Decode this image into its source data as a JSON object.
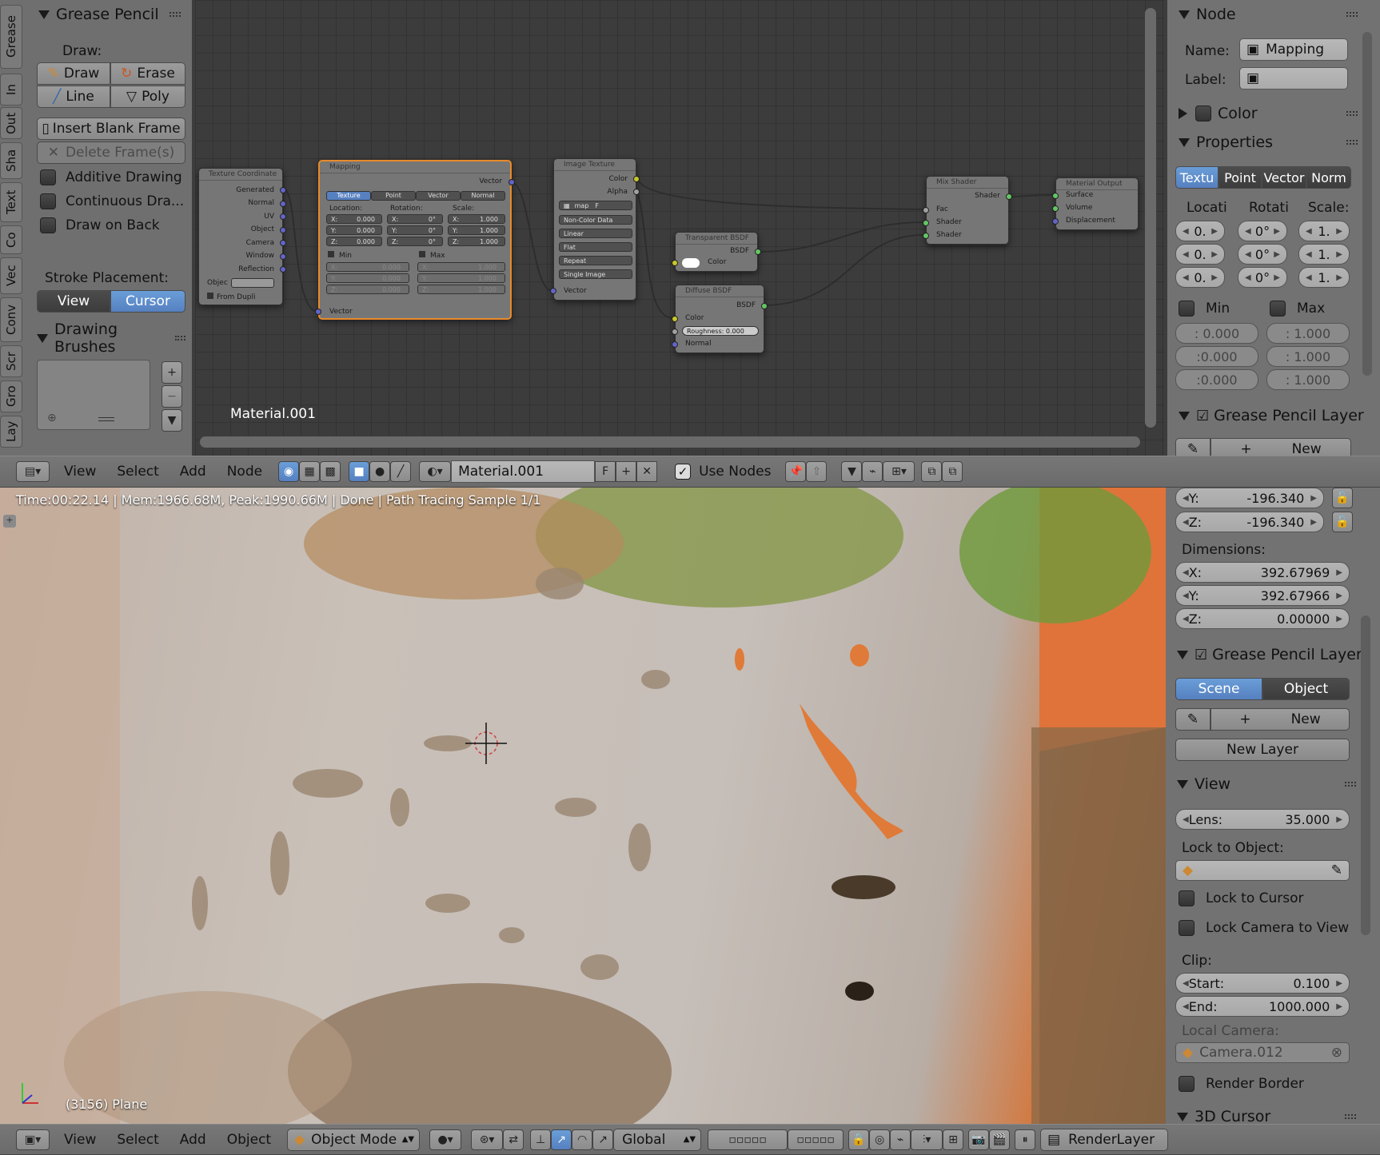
{
  "grease_pencil_panel": {
    "title": "Grease Pencil",
    "draw_label": "Draw:",
    "draw": "Draw",
    "erase": "Erase",
    "line": "Line",
    "poly": "Poly",
    "insert_blank_frame": "Insert Blank Frame",
    "delete_frames": "Delete Frame(s)",
    "additive_drawing": "Additive Drawing",
    "continuous_draw": "Continuous Dra...",
    "draw_on_back": "Draw on Back",
    "stroke_placement": "Stroke Placement:",
    "view": "View",
    "cursor": "Cursor",
    "drawing_brushes": "Drawing Brushes"
  },
  "vertical_tabs": [
    "Grease",
    "In",
    "Out",
    "Sha",
    "Text",
    "Co",
    "Vec",
    "Conv",
    "Scr",
    "Gro",
    "Lay"
  ],
  "node_editor": {
    "material_label": "Material.001",
    "nodes": {
      "texture_coordinate": {
        "title": "Texture Coordinate",
        "outputs": [
          "Generated",
          "Normal",
          "UV",
          "Object",
          "Camera",
          "Window",
          "Reflection"
        ],
        "object_label": "Objec",
        "from_dupli": "From Dupli"
      },
      "mapping": {
        "title": "Mapping",
        "output": "Vector",
        "tabs": [
          "Texture",
          "Point",
          "Vector",
          "Normal"
        ],
        "location": "Location:",
        "rotation": "Rotation:",
        "scale": "Scale:",
        "loc": [
          "X:",
          "0.000",
          "Y:",
          "0.000",
          "Z:",
          "0.000"
        ],
        "rot": [
          "X:",
          "0°",
          "Y:",
          "0°",
          "Z:",
          "0°"
        ],
        "scl": [
          "X:",
          "1.000",
          "Y:",
          "1.000",
          "Z:",
          "1.000"
        ],
        "min": "Min",
        "max": "Max",
        "min_vals": [
          "X:",
          "0.000",
          "Y:",
          "0.000",
          "Z:",
          "0.000"
        ],
        "max_vals": [
          "X:",
          "1.000",
          "Y:",
          "1.000",
          "Z:",
          "1.000"
        ],
        "input": "Vector"
      },
      "image_texture": {
        "title": "Image Texture",
        "outputs": [
          "Color",
          "Alpha"
        ],
        "image": "map",
        "f": "F",
        "options": [
          "Non-Color Data",
          "Linear",
          "Flat",
          "Repeat",
          "Single Image"
        ],
        "input": "Vector"
      },
      "transparent_bsdf": {
        "title": "Transparent BSDF",
        "output": "BSDF",
        "input": "Color"
      },
      "diffuse_bsdf": {
        "title": "Diffuse BSDF",
        "output": "BSDF",
        "inputs": [
          "Color",
          "Roughness: 0.000",
          "Normal"
        ]
      },
      "mix_shader": {
        "title": "Mix Shader",
        "output": "Shader",
        "inputs": [
          "Fac",
          "Shader",
          "Shader"
        ]
      },
      "material_output": {
        "title": "Material Output",
        "inputs": [
          "Surface",
          "Volume",
          "Displacement"
        ]
      }
    }
  },
  "node_sidebar": {
    "node_title": "Node",
    "name_label": "Name:",
    "name_value": "Mapping",
    "label_label": "Label:",
    "color": "Color",
    "properties": "Properties",
    "tabs": [
      "Textu",
      "Point",
      "Vector",
      "Norm"
    ],
    "cols": [
      "Locati",
      "Rotati",
      "Scale:"
    ],
    "loc": [
      "0.",
      "0.",
      "0."
    ],
    "rot": [
      "0°",
      "0°",
      "0°"
    ],
    "scl": [
      "1.",
      "1.",
      "1."
    ],
    "min": "Min",
    "max": "Max",
    "min_vals": [
      ": 0.000",
      ":0.000",
      ":0.000"
    ],
    "max_vals": [
      ": 1.000",
      ": 1.000",
      ": 1.000"
    ],
    "gp_layer": "Grease Pencil Layer",
    "new": "New"
  },
  "node_header": {
    "view": "View",
    "select": "Select",
    "add": "Add",
    "node": "Node",
    "material": "Material.001",
    "f": "F",
    "use_nodes": "Use Nodes"
  },
  "viewport": {
    "status": "Time:00:22.14 | Mem:1966.68M, Peak:1990.66M | Done | Path Tracing Sample 1/1",
    "object_info": "(3156) Plane"
  },
  "view_sidebar": {
    "y_scale": "Y:",
    "y_scale_val": "-196.340",
    "z_scale": "Z:",
    "z_scale_val": "-196.340",
    "dimensions": "Dimensions:",
    "dx": "X:",
    "dx_val": "392.67969",
    "dy": "Y:",
    "dy_val": "392.67966",
    "dz": "Z:",
    "dz_val": "0.00000",
    "gp_layer": "Grease Pencil Layer",
    "scene": "Scene",
    "object": "Object",
    "new": "New",
    "new_layer": "New Layer",
    "view": "View",
    "lens": "Lens:",
    "lens_val": "35.000",
    "lock_to_object": "Lock to Object:",
    "lock_to_cursor": "Lock to Cursor",
    "lock_camera": "Lock Camera to View",
    "clip": "Clip:",
    "start": "Start:",
    "start_val": "0.100",
    "end": "End:",
    "end_val": "1000.000",
    "local_camera": "Local Camera:",
    "camera": "Camera.012",
    "render_border": "Render Border",
    "cursor_3d": "3D Cursor"
  },
  "viewport_header": {
    "view": "View",
    "select": "Select",
    "add": "Add",
    "object": "Object",
    "mode": "Object Mode",
    "orientation": "Global",
    "render_layer": "RenderLayer"
  }
}
